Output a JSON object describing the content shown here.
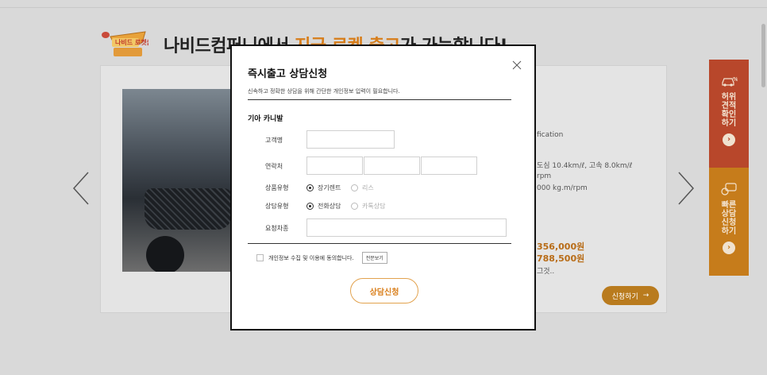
{
  "background": {
    "logo_text": "나비드 로켓출고",
    "headline_prefix": "나비드컴퍼니에서 ",
    "headline_accent": "지금 로켓 출고",
    "headline_suffix": "가 가능합니다!",
    "spec_lines": [
      "fication",
      "도심 10.4km/ℓ, 고속 8.0km/ℓ",
      "rpm",
      "000 kg.m/rpm"
    ],
    "price_1": "356,000원",
    "price_2": "788,500원",
    "price_note": "그것..",
    "apply_label": "신청하기",
    "apply_arrow": "→"
  },
  "side_buttons": [
    {
      "label": "허위 견적 확인 하기",
      "icon": "car-percent-icon",
      "color": "#b8472b"
    },
    {
      "label": "빠른 상담 신청 하기",
      "icon": "chat-bubble-icon",
      "color": "#c67c1b"
    }
  ],
  "modal": {
    "title": "즉시출고 상담신청",
    "description": "신속하고 정확한 상담을 위해 간단한 개인정보 입력이 필요합니다.",
    "brand": "기아 카니발",
    "fields": {
      "customer_name_label": "고객명",
      "customer_name_value": "",
      "contact_label": "연락처",
      "contact_values": [
        "",
        "",
        ""
      ],
      "product_type_label": "상품유형",
      "product_options": [
        "장기렌트",
        "리스"
      ],
      "product_selected": "장기렌트",
      "consult_type_label": "상담유형",
      "consult_options": [
        "전화상담",
        "카톡상담"
      ],
      "consult_selected": "전화상담",
      "requested_model_label": "요청차종",
      "requested_model_value": ""
    },
    "agree_label": "개인정보 수집 및 이용에 동의합니다.",
    "fulltext_label": "전문보기",
    "submit_label": "상담신청"
  }
}
